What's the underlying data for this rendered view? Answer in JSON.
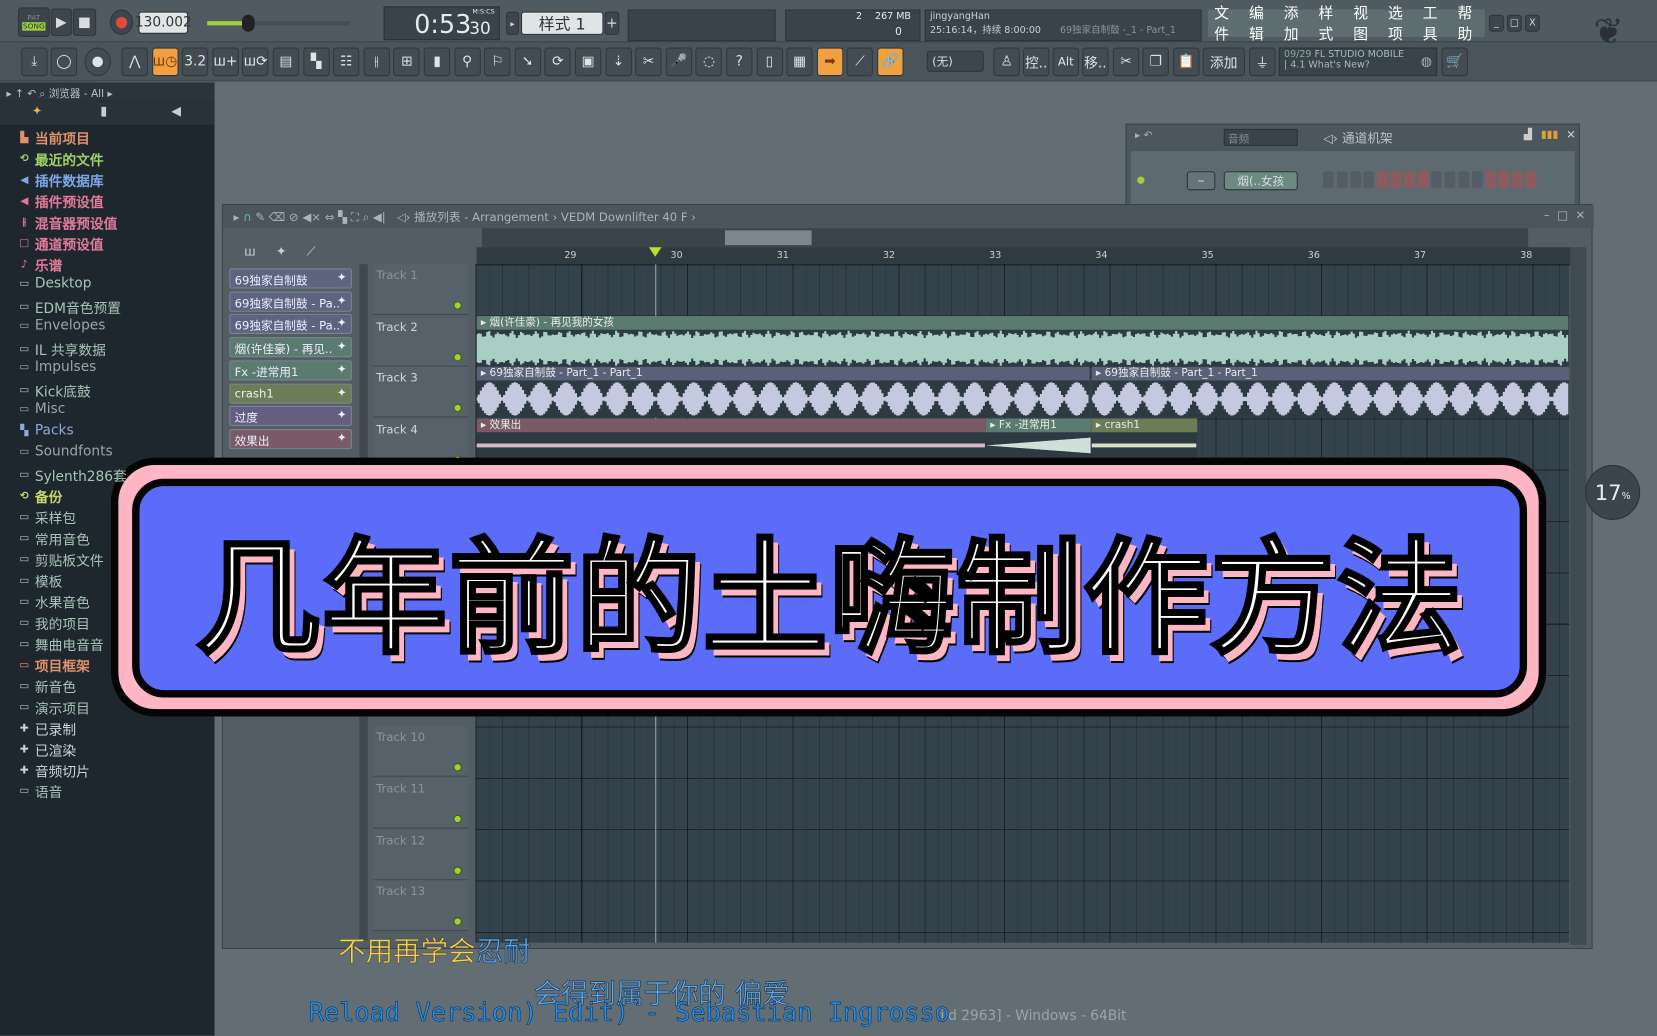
{
  "transport": {
    "mode_pat": "PAT",
    "mode_song": "SONG",
    "tempo": "130.002",
    "time": "0:53",
    "time_cs": "30",
    "time_label": "M:S:CS",
    "pattern": "样式 1",
    "pattern_add": "+"
  },
  "info": {
    "cpu": "2",
    "memory": "267 MB",
    "poly": "0",
    "user": "jingyangHan",
    "status": "25:16:14，持续 8:00:00",
    "hint": "69独家自制鼓 -_1 - Part_1"
  },
  "menu": [
    "文件",
    "编辑",
    "添加",
    "样式",
    "视图",
    "选项",
    "工具",
    "帮助"
  ],
  "window_controls": {
    "minimize": "_",
    "maximize": "□",
    "close": "X"
  },
  "toolbar_icons": [
    "download-icon",
    "knob-icon",
    "master-knob-icon",
    "metronome-icon",
    "wait-icon",
    "step-edit-icon",
    "piano-add-icon",
    "loop-record-icon",
    "playlist-icon",
    "pattern-icon",
    "channel-rack-icon",
    "mixer-icon",
    "browser-icon",
    "file-icon",
    "plugin-icon",
    "tempo-icon",
    "tools-icon",
    "reload-icon",
    "save-icon",
    "export-icon",
    "cut-icon",
    "mic-icon",
    "chat-icon",
    "help-icon",
    "window-icon",
    "keyboard-icon",
    "arrow-icon",
    "brush-icon",
    "link-icon"
  ],
  "toolbar_active": [
    4,
    26,
    28
  ],
  "toolbar_step": "3.2",
  "toolbar2": {
    "snap": "(无)",
    "ctrl": "控..",
    "alt": "Alt",
    "move": "移..",
    "add": "添加"
  },
  "news": {
    "date": "09/29",
    "title": "FL STUDIO MOBILE",
    "subtitle": "4.1 What's New?"
  },
  "browser": {
    "header": "浏览器 - All",
    "items": [
      {
        "label": "当前项目",
        "color": "#e0906a",
        "icon": "▙"
      },
      {
        "label": "最近的文件",
        "color": "#9fd06a",
        "icon": "⟲"
      },
      {
        "label": "插件数据库",
        "color": "#7fa6e6",
        "icon": "◀"
      },
      {
        "label": "插件预设值",
        "color": "#e07a9a",
        "icon": "◀"
      },
      {
        "label": "混音器预设值",
        "color": "#e07a9a",
        "icon": "⫲"
      },
      {
        "label": "通道预设值",
        "color": "#e07a9a",
        "icon": "□"
      },
      {
        "label": "乐谱",
        "color": "#e07a9a",
        "icon": "♪"
      },
      {
        "label": "Desktop",
        "color": "#a9c3b8",
        "icon": "▭"
      },
      {
        "label": "EDM音色预置",
        "color": "#a9c3b8",
        "icon": "▭"
      },
      {
        "label": "Envelopes",
        "color": "#9aa5aa",
        "icon": "▭"
      },
      {
        "label": "IL 共享数据",
        "color": "#a9c3b8",
        "icon": "▭"
      },
      {
        "label": "Impulses",
        "color": "#9aa5aa",
        "icon": "▭"
      },
      {
        "label": "Kick底鼓",
        "color": "#a9c3b8",
        "icon": "▭"
      },
      {
        "label": "Misc",
        "color": "#9aa5aa",
        "icon": "▭"
      },
      {
        "label": "Packs",
        "color": "#8ea8d8",
        "icon": "▚"
      },
      {
        "label": "Soundfonts",
        "color": "#9aa5aa",
        "icon": "▭"
      },
      {
        "label": "Sylenth286套",
        "color": "#a9c3b8",
        "icon": "▭"
      },
      {
        "label": "备份",
        "color": "#c6d86a",
        "icon": "⟲"
      },
      {
        "label": "采样包",
        "color": "#a9c3b8",
        "icon": "▭"
      },
      {
        "label": "常用音色",
        "color": "#a9c3b8",
        "icon": "▭"
      },
      {
        "label": "剪贴板文件",
        "color": "#a9c3b8",
        "icon": "▭"
      },
      {
        "label": "模板",
        "color": "#a9c3b8",
        "icon": "▭"
      },
      {
        "label": "水果音色",
        "color": "#a9c3b8",
        "icon": "▭"
      },
      {
        "label": "我的项目",
        "color": "#a9c3b8",
        "icon": "▭"
      },
      {
        "label": "舞曲电音音",
        "color": "#a9c3b8",
        "icon": "▭"
      },
      {
        "label": "项目框架",
        "color": "#e0906a",
        "icon": "▭"
      },
      {
        "label": "新音色",
        "color": "#a9c3b8",
        "icon": "▭"
      },
      {
        "label": "演示项目",
        "color": "#a9c3b8",
        "icon": "▭"
      },
      {
        "label": "已录制",
        "color": "#c8d4dc",
        "icon": "✚"
      },
      {
        "label": "已渲染",
        "color": "#c8d4dc",
        "icon": "✚"
      },
      {
        "label": "音频切片",
        "color": "#c8d4dc",
        "icon": "✚"
      },
      {
        "label": "语音",
        "color": "#a9c3b8",
        "icon": "▭"
      }
    ]
  },
  "channel_rack": {
    "title": "通道机架",
    "filter": "音频",
    "channel": "烟(..女孩"
  },
  "playlist": {
    "title": "播放列表 - Arrangement",
    "breadcrumb": "VEDM Downlifter 40 F",
    "ruler": [
      "29",
      "30",
      "31",
      "32",
      "33",
      "34",
      "35",
      "36",
      "37",
      "38"
    ],
    "patterns": [
      {
        "label": "69独家自制鼓",
        "color": "#5d6480"
      },
      {
        "label": "69独家自制鼓 - Pa..",
        "color": "#5d6480"
      },
      {
        "label": "69独家自制鼓 - Pa..",
        "color": "#5d6480"
      },
      {
        "label": "烟(许佳豪) - 再见..",
        "color": "#5b7b70"
      },
      {
        "label": "Fx -进常用1",
        "color": "#5b7b70"
      },
      {
        "label": "crash1",
        "color": "#6c7d55"
      },
      {
        "label": "过度",
        "color": "#645e80"
      },
      {
        "label": "效果出",
        "color": "#7a5a66"
      }
    ],
    "tracks": [
      "Track 1",
      "Track 2",
      "Track 3",
      "Track 4",
      "Track 10",
      "Track 11",
      "Track 12",
      "Track 13"
    ],
    "clips": [
      {
        "label": "烟(许佳豪) - 再见我的女孩",
        "color": "#5c7b70",
        "wave": "#a9cfc4"
      },
      {
        "label": "69独家自制鼓 - Part_1 - Part_1",
        "color": "#5a6078",
        "wave": "#c5c9e0"
      },
      {
        "label": "69独家自制鼓 - Part_1 - Part_1",
        "color": "#5a6078",
        "wave": "#c5c9e0"
      },
      {
        "label": "效果出",
        "color": "#7a5a66",
        "wave": "#d8b8c4"
      },
      {
        "label": "Fx -进常用1",
        "color": "#5b7b70",
        "wave": "#cfe0d8"
      },
      {
        "label": "crash1",
        "color": "#6c7d55",
        "wave": "#d8e0c0"
      }
    ]
  },
  "overlay": {
    "title": "几年前的土嗨制作方法",
    "colors": {
      "fill": "#5b6cf8",
      "border": "#ffb6c4"
    }
  },
  "lyrics": {
    "line1_sung": "不用再学会",
    "line1_rest": "忍耐",
    "line2": "会得到属于你的 偏爱",
    "song": "Reload Version) Edit) - Sebastian Ingrosso"
  },
  "statusbar": "ild 2963] - Windows - 64Bit",
  "zoom_badge": {
    "value": "17",
    "unit": "%"
  }
}
